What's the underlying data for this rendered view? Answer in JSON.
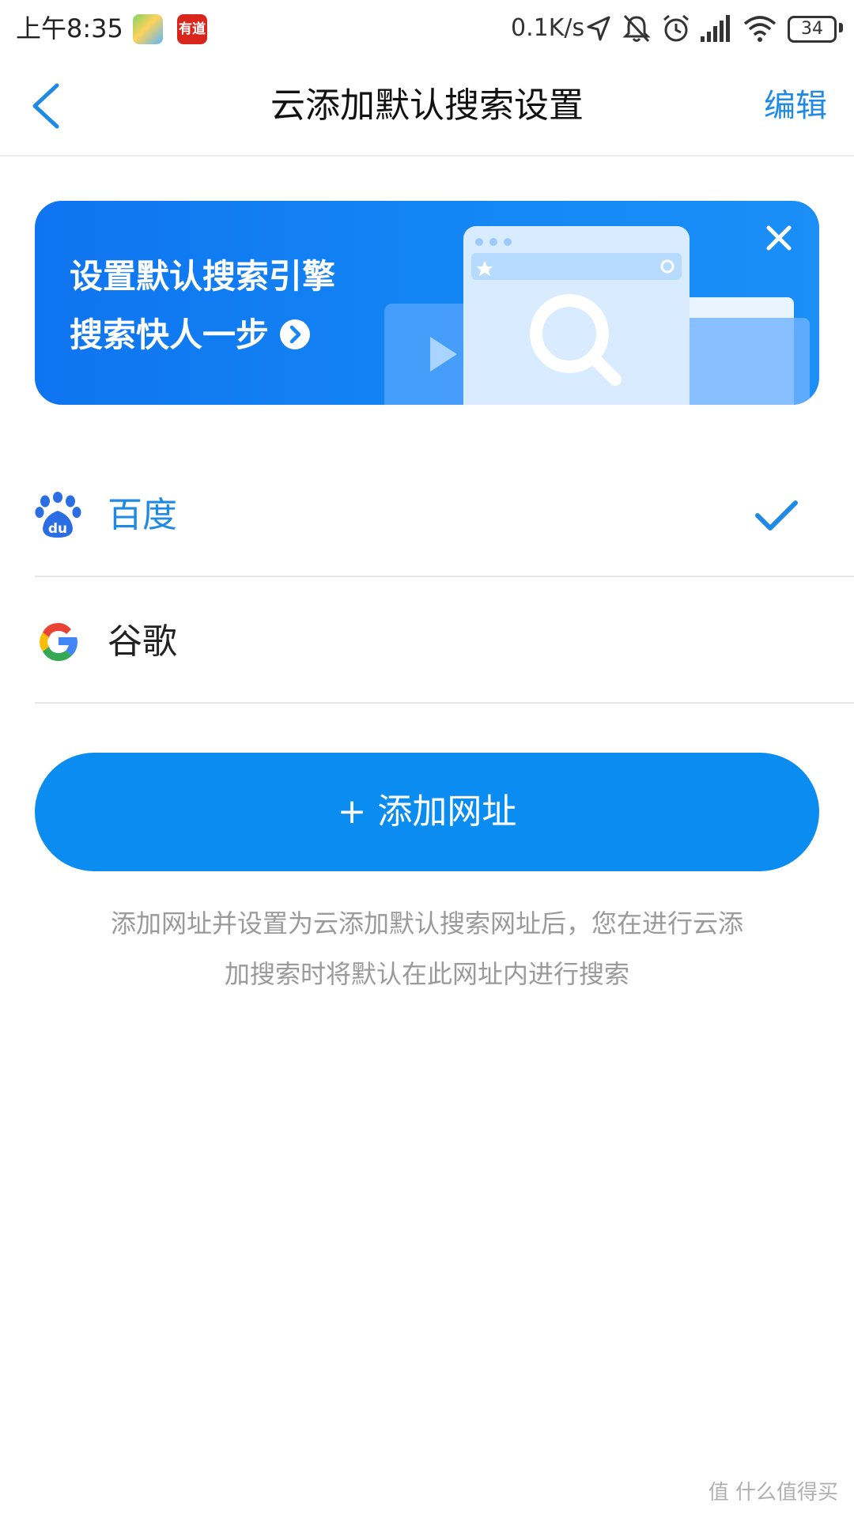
{
  "status_bar": {
    "time": "上午8:35",
    "app_badge_text": "有道",
    "network_speed": "0.1K/s",
    "battery_level": "34"
  },
  "nav": {
    "back_icon": "chevron-left-icon",
    "title": "云添加默认搜索设置",
    "edit_label": "编辑"
  },
  "banner": {
    "line1": "设置默认搜索引擎",
    "line2": "搜索快人一步",
    "close_icon": "close-icon"
  },
  "engines": [
    {
      "name": "百度",
      "icon": "baidu-icon",
      "selected": true
    },
    {
      "name": "谷歌",
      "icon": "google-icon",
      "selected": false
    }
  ],
  "add_button": {
    "label": "+ 添加网址"
  },
  "hint": {
    "line1": "添加网址并设置为云添加默认搜索网址后，您在进行云添",
    "line2": "加搜索时将默认在此网址内进行搜索"
  },
  "watermark": "值 什么值得买",
  "colors": {
    "accent": "#1f8ae6",
    "button": "#0a8cf0",
    "banner": "#1488f5"
  }
}
